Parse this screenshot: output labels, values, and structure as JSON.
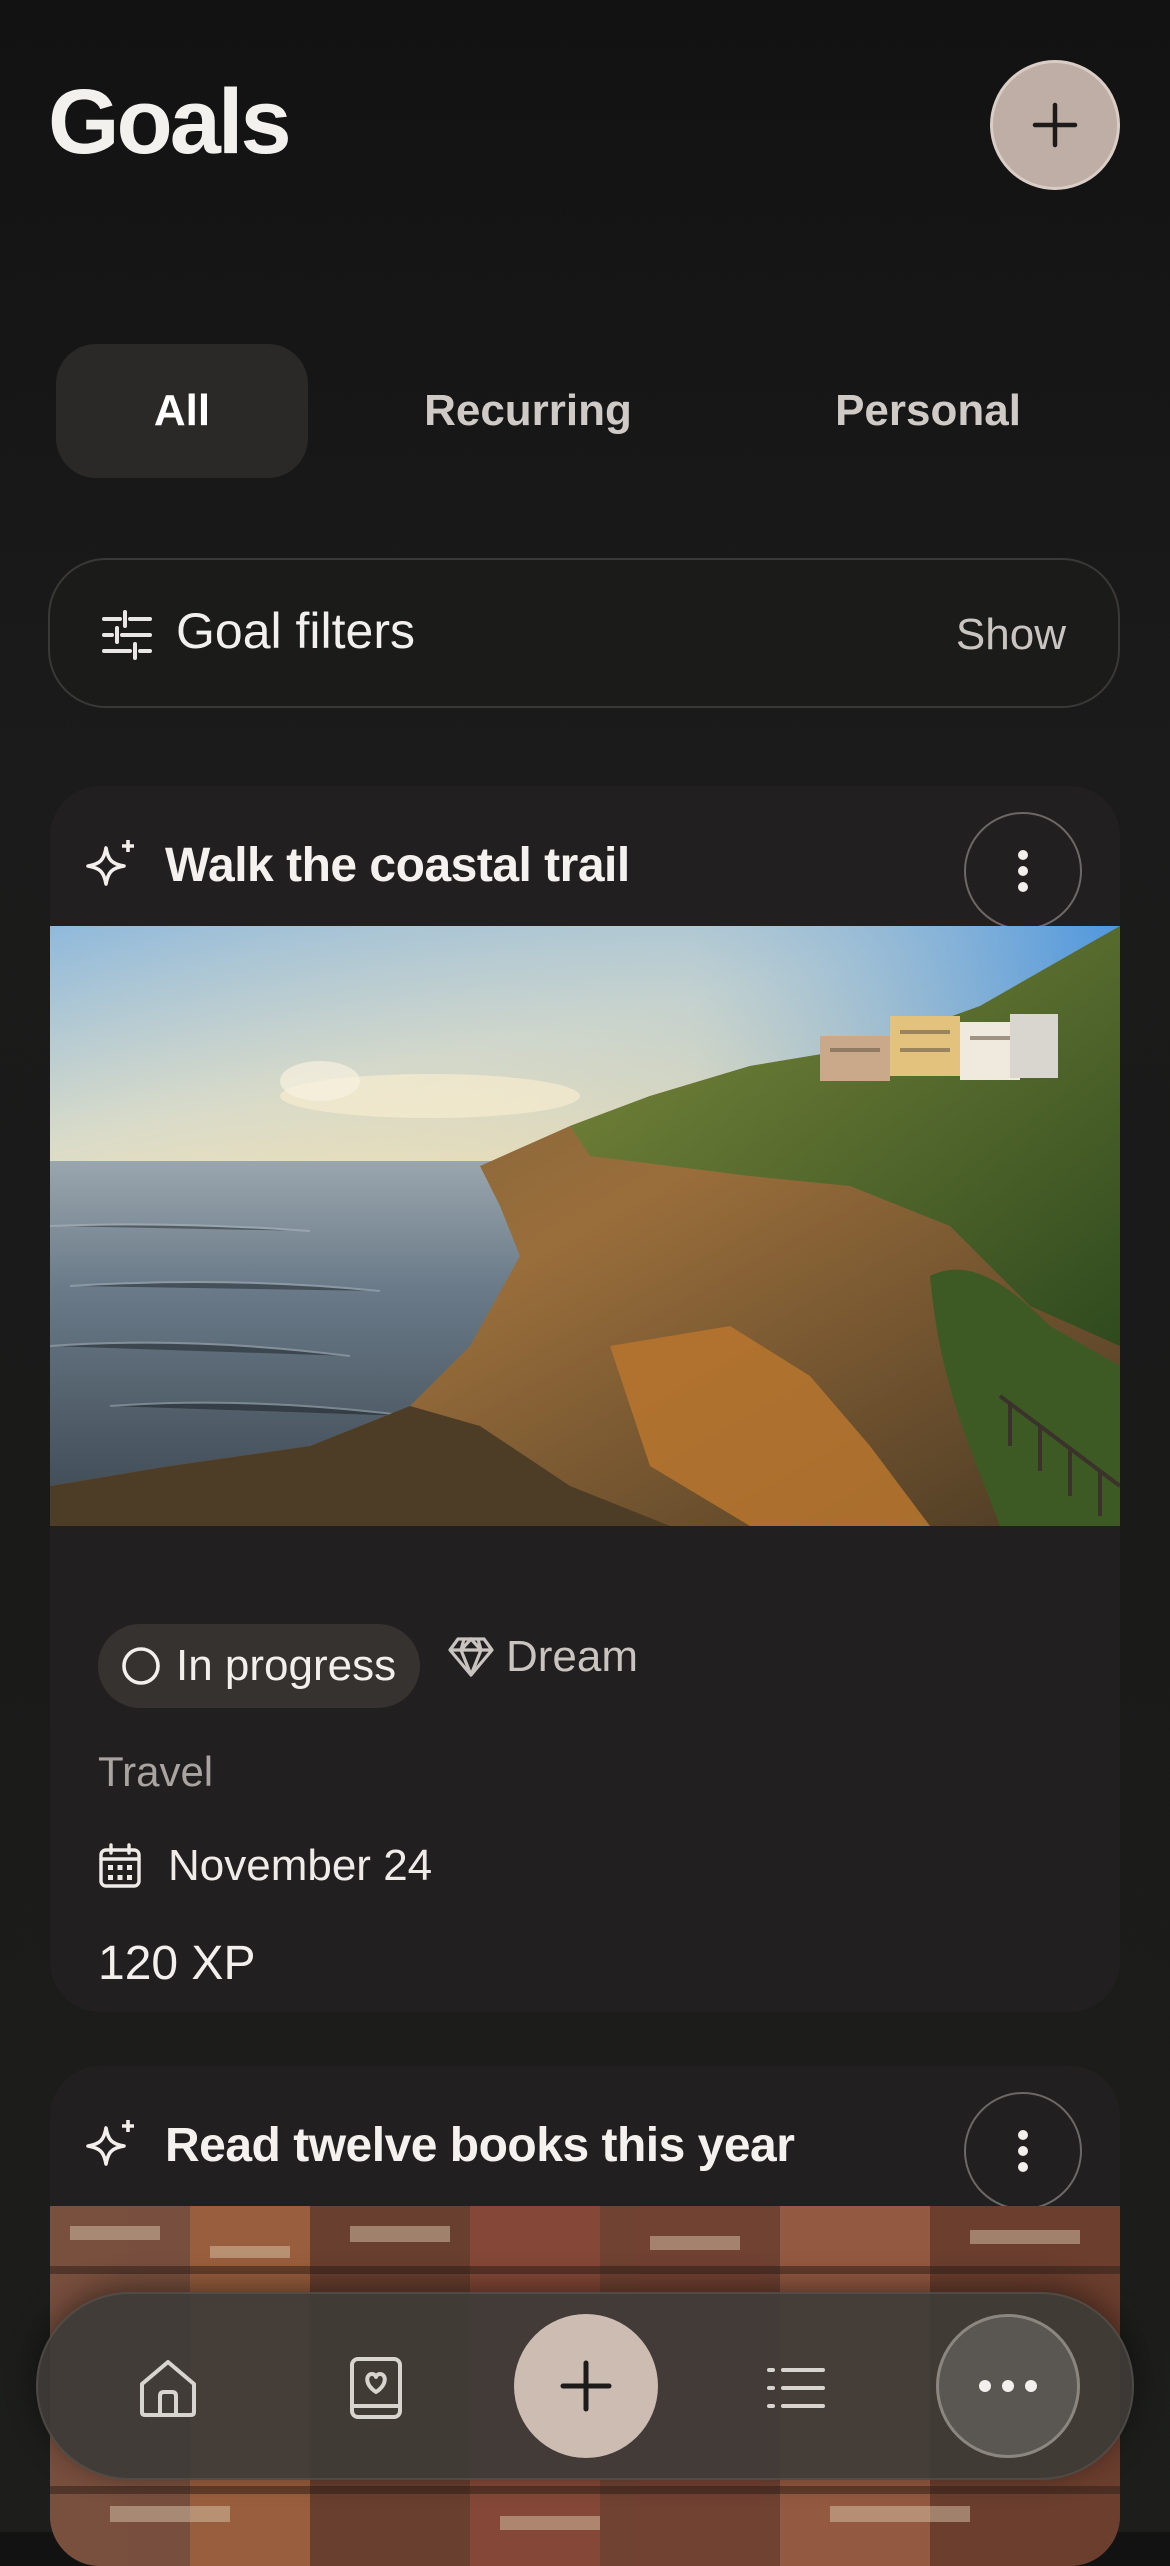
{
  "header": {
    "title": "Goals",
    "add_button_icon": "plus-icon"
  },
  "tabs": [
    {
      "label": "All",
      "active": true
    },
    {
      "label": "Recurring",
      "active": false
    },
    {
      "label": "Personal",
      "active": false
    }
  ],
  "filters": {
    "label": "Goal filters",
    "action": "Show",
    "icon": "sliders-icon"
  },
  "goals": [
    {
      "title": "Walk the coastal trail",
      "status": "In progress",
      "tier": "Dream",
      "category": "Travel",
      "date": "November 24",
      "xp": "120 XP",
      "image": "coastal-cliff-photo"
    },
    {
      "title": "Read twelve books this year",
      "image": "bookshelf-photo"
    }
  ],
  "bottom_nav": {
    "items": [
      "home-icon",
      "journal-icon",
      "plus-icon",
      "list-icon",
      "more-icon"
    ]
  },
  "colors": {
    "accent": "#bfaea5",
    "card": "#211f1f",
    "background": "#151515"
  }
}
